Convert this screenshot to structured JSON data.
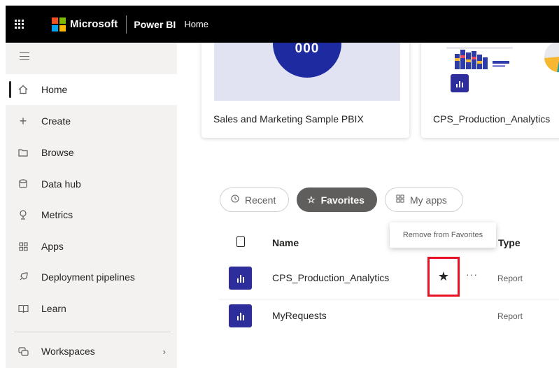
{
  "header": {
    "brand": "Microsoft",
    "app": "Power BI",
    "breadcrumb": "Home"
  },
  "sidebar": {
    "items": [
      {
        "label": "Home",
        "icon": "home-icon",
        "active": true
      },
      {
        "label": "Create",
        "icon": "plus-icon"
      },
      {
        "label": "Browse",
        "icon": "folder-icon"
      },
      {
        "label": "Data hub",
        "icon": "database-icon"
      },
      {
        "label": "Metrics",
        "icon": "trophy-icon"
      },
      {
        "label": "Apps",
        "icon": "apps-icon"
      },
      {
        "label": "Deployment pipelines",
        "icon": "rocket-icon"
      },
      {
        "label": "Learn",
        "icon": "book-icon"
      },
      {
        "label": "Workspaces",
        "icon": "workspaces-icon"
      }
    ]
  },
  "cards": [
    {
      "title": "Sales and Marketing Sample PBIX",
      "thumb_text": "000"
    },
    {
      "title": "CPS_Production_Analytics"
    }
  ],
  "tabs": {
    "recent": "Recent",
    "favorites": "Favorites",
    "my_apps": "My apps"
  },
  "list": {
    "col_name": "Name",
    "col_type": "Type",
    "tooltip": "Remove from Favorites",
    "more": "···",
    "rows": [
      {
        "name": "CPS_Production_Analytics",
        "type": "Report",
        "favorite": true
      },
      {
        "name": "MyRequests",
        "type": "Report"
      }
    ]
  },
  "colors": {
    "topbar": "#000000",
    "sidebar": "#f3f2f1",
    "report_icon": "#2d2d9b",
    "highlight": "#e81123",
    "ms_red": "#f25022",
    "ms_green": "#7fba00",
    "ms_blue": "#00a4ef",
    "ms_yellow": "#ffb900"
  }
}
